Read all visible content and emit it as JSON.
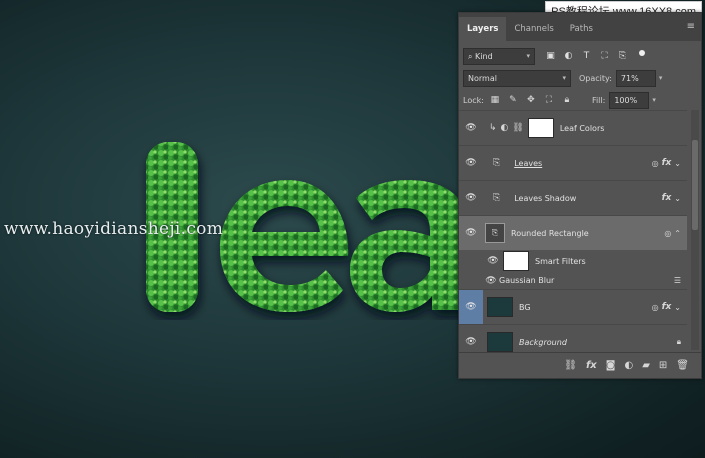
{
  "watermark": "PS教程论坛 www.16XX8.com",
  "url_overlay": "www.haoyidiansheji.com",
  "canvas_text": "lea",
  "panel": {
    "tabs": [
      {
        "label": "Layers",
        "active": true
      },
      {
        "label": "Channels",
        "active": false
      },
      {
        "label": "Paths",
        "active": false
      }
    ],
    "menu_icon": "panel-menu-icon",
    "filter": {
      "label": "Kind"
    },
    "blend": {
      "mode": "Normal",
      "opacity_label": "Opacity:",
      "opacity_value": "71%"
    },
    "lock": {
      "label": "Lock:",
      "fill_label": "Fill:",
      "fill_value": "100%"
    },
    "layers": [
      {
        "name": "Leaf Colors",
        "thumb": "white",
        "visible": true
      },
      {
        "name": "Leaves",
        "thumb": "none",
        "visible": true,
        "fx": "fx"
      },
      {
        "name": "Leaves Shadow",
        "thumb": "none",
        "visible": true,
        "fx": "fx"
      },
      {
        "name": "Rounded Rectangle",
        "thumb": "smart",
        "visible": true,
        "selected": true
      },
      {
        "name": "Smart Filters",
        "thumb": "white",
        "visible": true
      },
      {
        "name": "Gaussian Blur",
        "visible": true
      },
      {
        "name": "BG",
        "thumb": "dark",
        "visible": true,
        "fx": "fx"
      },
      {
        "name": "Background",
        "thumb": "dark",
        "visible": true
      }
    ]
  }
}
